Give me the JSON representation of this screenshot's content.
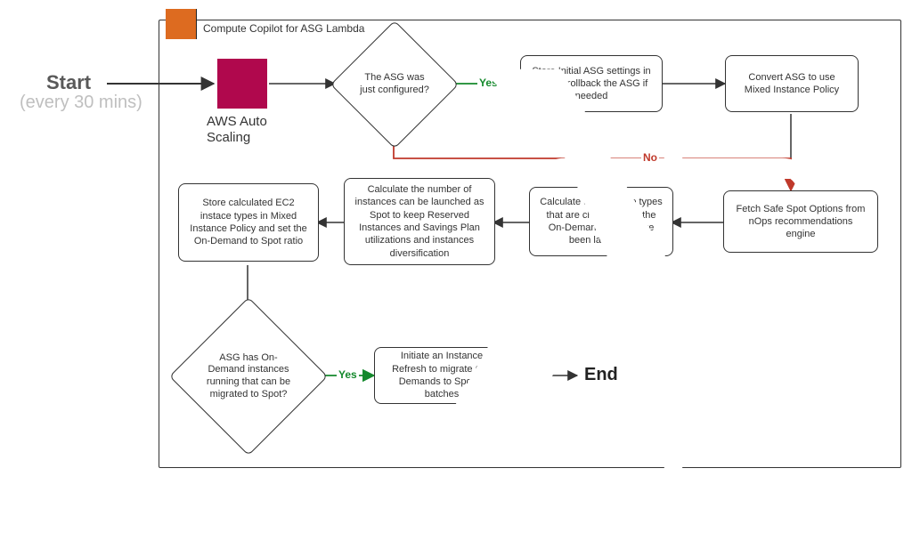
{
  "header": {
    "badge_label": "Compute Copilot for ASG Lambda"
  },
  "start": {
    "title": "Start",
    "subtitle": "(every 30 mins)"
  },
  "aws": {
    "label": "AWS Auto Scaling"
  },
  "end": {
    "label": "End"
  },
  "edges": {
    "yes_top": "Yes",
    "no_mid": "No",
    "yes_bot": "Yes"
  },
  "nodes": {
    "diamond_configured": "The ASG was just configured?",
    "box_store_initial": "Store Initial ASG settings in tags to rollback the ASG if needed",
    "box_convert_mixed": "Convert ASG to use Mixed Instance Policy",
    "box_fetch_safe": "Fetch Safe Spot Options from nOps recommendations engine",
    "box_calc_types": "Calculate the instance types that are cheaper than the On-Demand would have been launched",
    "box_calc_spot_count": "Calculate the number of instances can be launched as Spot to keep Reserved Instances and Savings Plan utilizations and instances diversification",
    "box_store_calc": "Store calculated EC2 instace types in Mixed Instance Policy and set the On-Demand to Spot ratio",
    "diamond_has_ondemand": "ASG has On-Demand instances running that can be migrated to Spot?",
    "box_refresh": "Initiate an Instance Refresh to migrate On-Demands to Spot in batches"
  }
}
